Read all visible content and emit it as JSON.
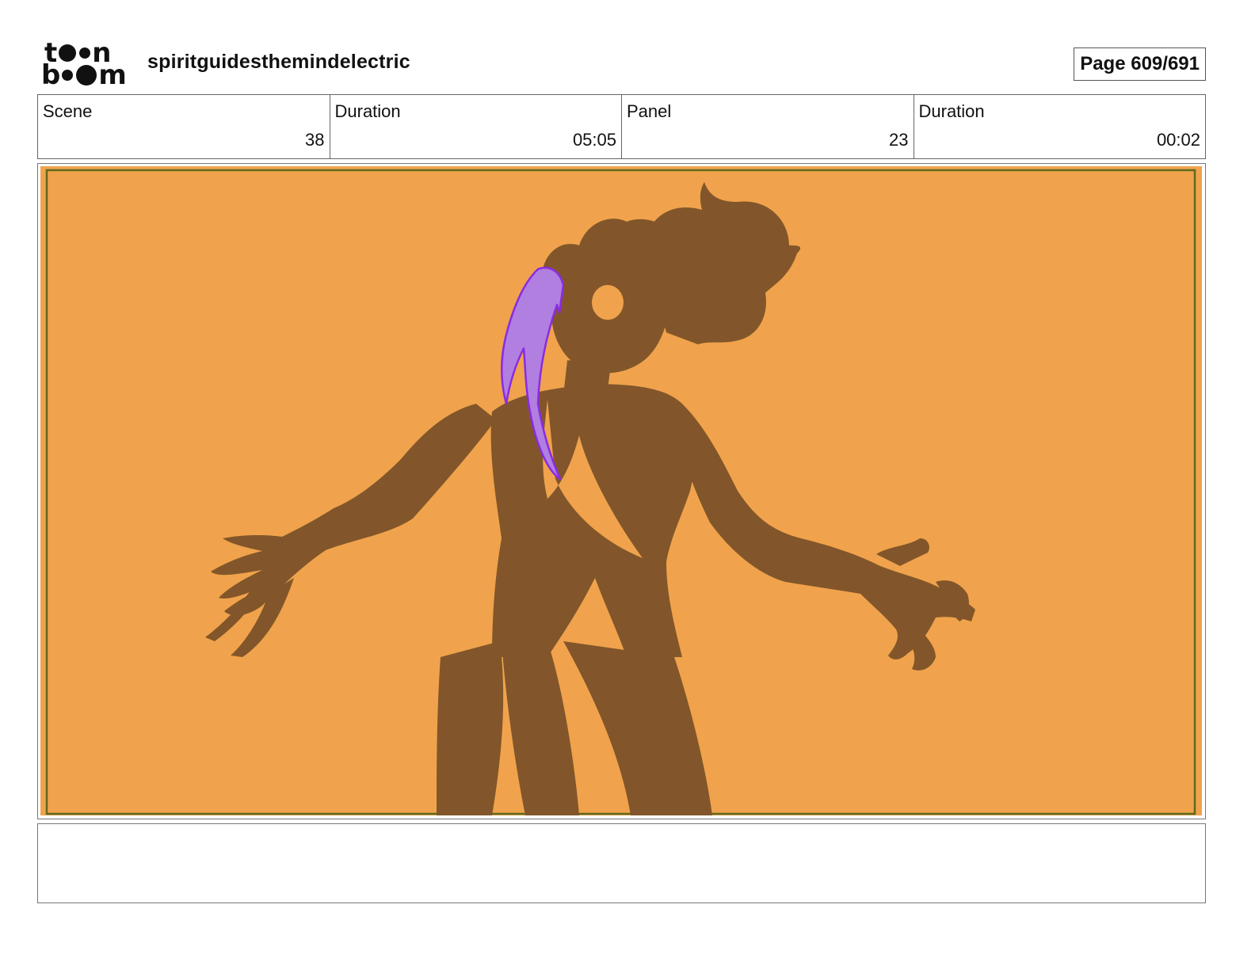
{
  "header": {
    "logo": {
      "line1": "toon",
      "line2": "boom"
    },
    "project_title": "spiritguidesthemindelectric",
    "page_indicator": "Page 609/691"
  },
  "info": {
    "scene_label": "Scene",
    "scene_value": "38",
    "scene_duration_label": "Duration",
    "scene_duration_value": "05:05",
    "panel_label": "Panel",
    "panel_value": "23",
    "panel_duration_label": "Duration",
    "panel_duration_value": "00:02"
  },
  "panel": {
    "background_color": "#F0A34C",
    "safe_frame_color": "#5E6A1C",
    "silhouette_color": "#82562A",
    "accent_color": "#B07FE0",
    "accent_stroke": "#8A2BE2"
  },
  "notes": {
    "text": ""
  }
}
